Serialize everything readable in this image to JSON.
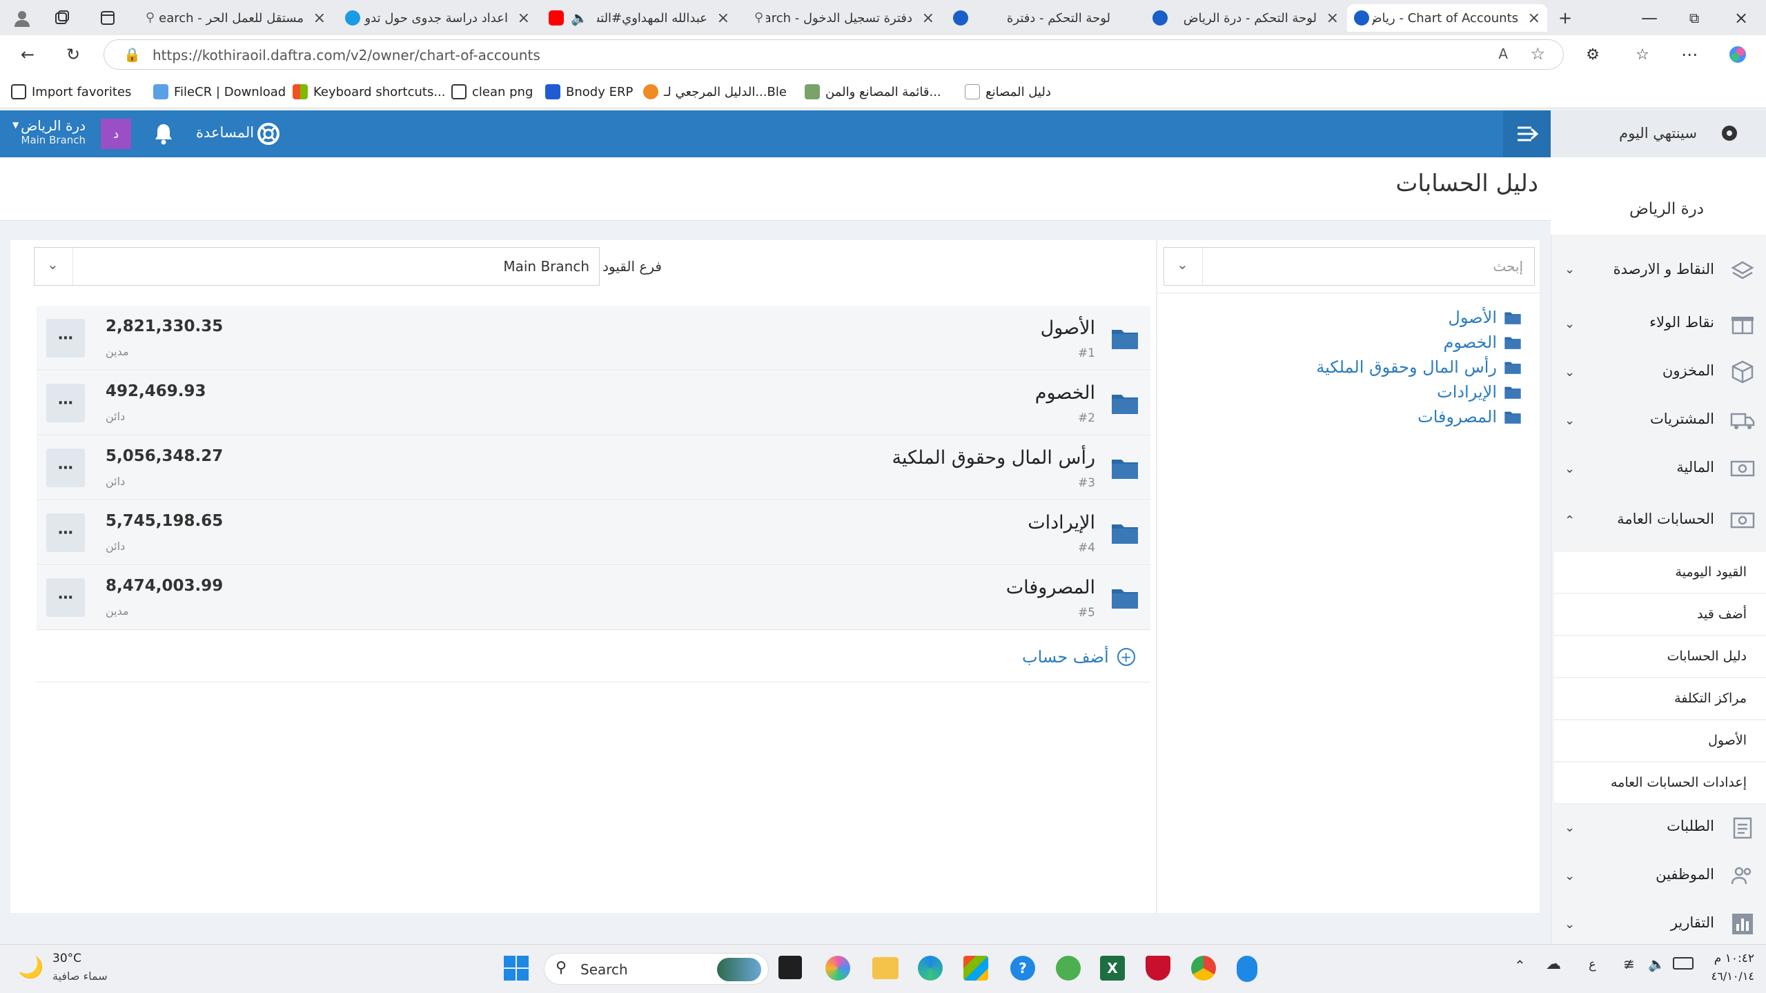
{
  "browser": {
    "tabs": [
      {
        "title": "مستقل للعمل الحر - earch",
        "favicon_color": "#5f6368"
      },
      {
        "title": "اعداد دراسة جدوى حول تدو",
        "favicon_color": "#1a9be6"
      },
      {
        "title": "عبدالله المهداوي#التش",
        "favicon_color": "#ff0000"
      },
      {
        "title": "دفترة تسجيل الدخول - arch",
        "favicon_color": "#5f6368"
      },
      {
        "title": "لوحة التحكم - دفترة",
        "favicon_color": "#1a5ec9"
      },
      {
        "title": "لوحة التحكم - درة الرياض",
        "favicon_color": "#1a5ec9"
      },
      {
        "title": "Chart of Accounts - رياض",
        "favicon_color": "#1a5ec9"
      }
    ],
    "url": "https://kothiraoil.daftra.com/v2/owner/chart-of-accounts",
    "favorites": [
      "Import favorites",
      "FileCR | Download",
      "Keyboard shortcuts...",
      "clean png",
      "Bnody ERP",
      "الدليل المرجعي لـ...Ble",
      "قائمة المصانع والمن...",
      "دليل المصانع"
    ]
  },
  "header": {
    "branch_name": "درة الرياض",
    "branch_sub": "Main Branch",
    "avatar_letter": "د",
    "help_label": "المساعدة",
    "sidebar_top_label": "سينتهي اليوم",
    "accent_color": "#2b7cc0"
  },
  "page": {
    "title": "دليل الحسابات",
    "branch_filter_label": "فرع القيود",
    "branch_filter_value": "Main Branch",
    "search_placeholder": "إبحث",
    "add_account_label": "أضف حساب"
  },
  "accounts": [
    {
      "name": "الأصول",
      "code": "#1",
      "amount": "2,821,330.35",
      "type": "مدين"
    },
    {
      "name": "الخصوم",
      "code": "#2",
      "amount": "492,469.93",
      "type": "دائن"
    },
    {
      "name": "رأس المال وحقوق الملكية",
      "code": "#3",
      "amount": "5,056,348.27",
      "type": "دائن"
    },
    {
      "name": "الإيرادات",
      "code": "#4",
      "amount": "5,745,198.65",
      "type": "دائن"
    },
    {
      "name": "المصروفات",
      "code": "#5",
      "amount": "8,474,003.99",
      "type": "مدين"
    }
  ],
  "tree": [
    "الأصول",
    "الخصوم",
    "رأس المال وحقوق الملكية",
    "الإيرادات",
    "المصروفات"
  ],
  "sidebar": {
    "company": "درة الرياض",
    "items": [
      {
        "label": "النقاط و الارصدة"
      },
      {
        "label": "نقاط الولاء"
      },
      {
        "label": "المخزون"
      },
      {
        "label": "المشتريات"
      },
      {
        "label": "المالية"
      },
      {
        "label": "الحسابات العامة"
      }
    ],
    "sub_items": [
      "القيود اليومية",
      "أضف قيد",
      "دليل الحسابات",
      "مراكز التكلفة",
      "الأصول",
      "إعدادات الحسابات العامه"
    ],
    "bottom_items": [
      {
        "label": "الطلبات"
      },
      {
        "label": "الموظفين"
      },
      {
        "label": "التقارير"
      }
    ]
  },
  "taskbar": {
    "weather_temp": "30°C",
    "weather_desc": "سماء صافية",
    "search_label": "Search",
    "time": "١٠:٤٢ م",
    "date": "٤٦/١٠/١٤",
    "lang": "ع"
  }
}
